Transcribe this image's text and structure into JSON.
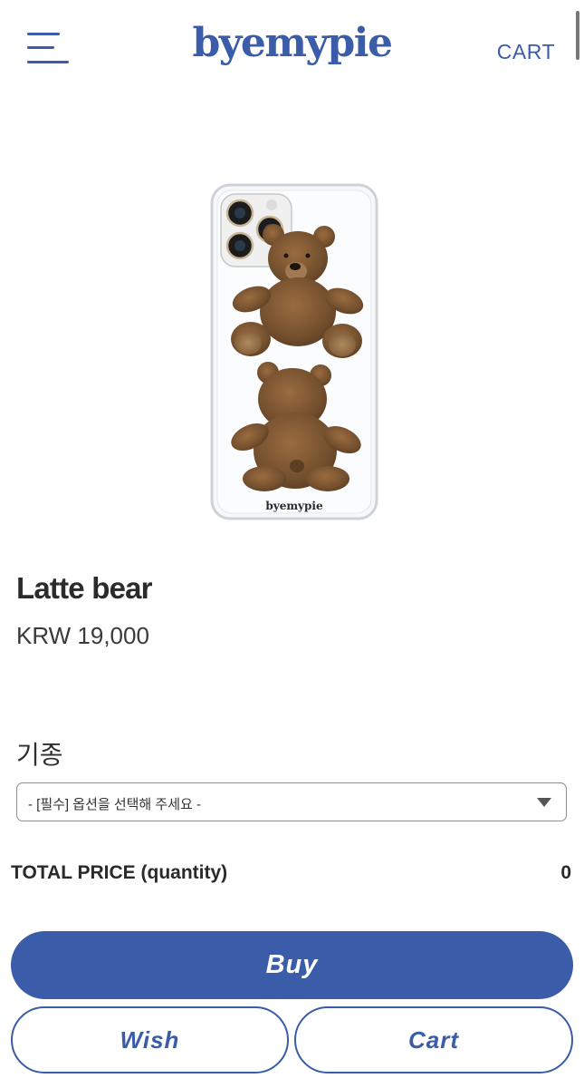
{
  "header": {
    "logo_text": "byemypie",
    "cart_label": "CART",
    "menu_icon": "hamburger-menu-icon"
  },
  "product": {
    "image_brand_text": "byemypie",
    "name": "Latte bear",
    "price": "KRW 19,000"
  },
  "option": {
    "label": "기종",
    "selected": "- [필수] 옵션을 선택해 주세요 -",
    "caret_icon": "caret-down-icon"
  },
  "total": {
    "label": "TOTAL PRICE (quantity)",
    "value": "0"
  },
  "buttons": {
    "buy": "Buy",
    "wish": "Wish",
    "cart": "Cart"
  },
  "colors": {
    "brand": "#3b5ca8",
    "bear_fur": "#7a5230"
  }
}
